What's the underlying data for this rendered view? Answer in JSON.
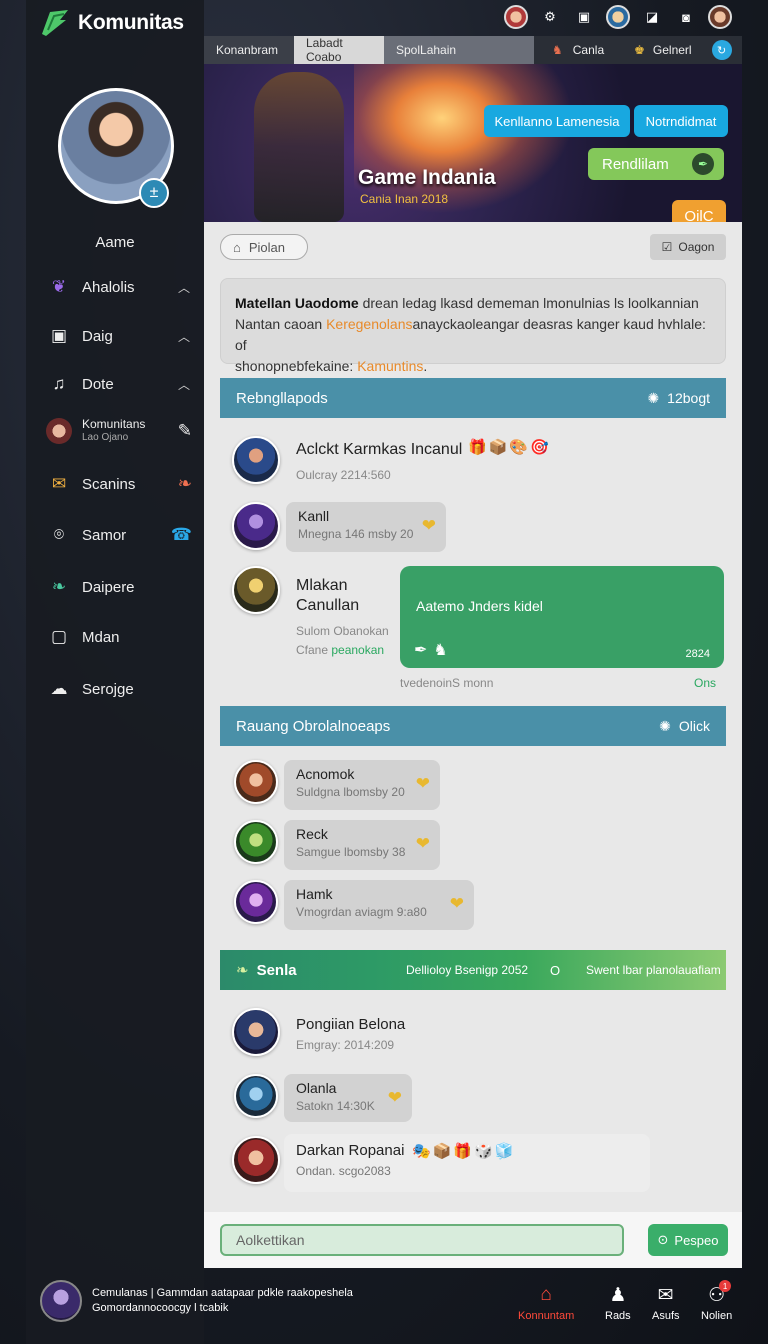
{
  "app": {
    "title": "Komunitas"
  },
  "colors": {
    "accent": "#18a8e0",
    "green": "#39a066",
    "section": "#4a90a8",
    "nav_active": "#ff4a3a"
  },
  "top_icons": [
    "avatar-icon",
    "gear-icon",
    "bookmark-icon",
    "avatar-icon",
    "chart-icon",
    "camera-icon",
    "avatar-icon"
  ],
  "sidebar": {
    "profile_name": "Aame",
    "profile_badge": "±",
    "items": [
      {
        "label": "Ahalolis",
        "icon": "feather-icon"
      },
      {
        "label": "Daig",
        "icon": "document-icon"
      },
      {
        "label": "Dote",
        "icon": "music-icon"
      },
      {
        "label": "Komunitans",
        "sub": "Lao Ojano",
        "icon": "avatar-icon"
      },
      {
        "label": "Scanins",
        "icon": "mail-icon"
      },
      {
        "label": "Samor",
        "icon": "pin-icon"
      },
      {
        "label": "Daipere",
        "icon": "leaf-icon"
      },
      {
        "label": "Mdan",
        "icon": "square-icon"
      },
      {
        "label": "Serojge",
        "icon": "cloud-icon"
      }
    ]
  },
  "tabs": [
    {
      "label": "Konanbram"
    },
    {
      "label": "Labadt Coabo"
    },
    {
      "label": "SpolLahain"
    },
    {
      "label": "Canla"
    },
    {
      "label": "Gelnerl"
    }
  ],
  "hero": {
    "title": "Game Indania",
    "subtitle": "Cania Inan 2018",
    "btn1": "Kenllanno Lamenesia",
    "btn2": "Notrndidmat",
    "btn3": "Rendlilam",
    "btn4": "OilC"
  },
  "toolbar": {
    "pill": "Piolan",
    "right_btn": "Oagon"
  },
  "info": {
    "bold": "Matellan Uaodome",
    "line1_rest": " drean ledag lkasd dememan lmonulnias ls loolkannian",
    "line2_a": "Nantan caoan ",
    "line2_orange": "Keregenolans",
    "line2_b": "anayckaoleangar deasras kanger kaud hvhlale: of",
    "line3_a": "shonopnebfekaine: ",
    "line3_orange": "Kamuntins",
    "line3_b": "."
  },
  "section1": {
    "title": "Rebngllapods",
    "right": "12bogt",
    "posts": [
      {
        "name": "Aclckt Karmkas Incanul",
        "meta": "Oulcray 2214:560"
      },
      {
        "name": "Kanll",
        "meta": "Mnegna 146 msby 20"
      },
      {
        "name": "Mlakan Canullan",
        "meta1": "Sulom Obanokan",
        "meta2a": "Cfane ",
        "meta2b": "peanokan"
      }
    ],
    "green_bubble": {
      "text": "Aatemo Jnders kidel",
      "date": "2824"
    },
    "footer_left": "tvedenoinS monn",
    "footer_right": "Ons"
  },
  "section2": {
    "title": "Rauang Obrolalnoeaps",
    "right": "Olick",
    "items": [
      {
        "name": "Acnomok",
        "meta": "Suldgna lbomsby 20"
      },
      {
        "name": "Reck",
        "meta": "Samgue lbomsby 38"
      },
      {
        "name": "Hamk",
        "meta": "Vmogrdan aviagm 9:a80"
      }
    ]
  },
  "section3": {
    "title": "Senla",
    "mid": "Dellioloy Bsenigp 2052",
    "num": "O",
    "right": "Swent lbar planolauafiam",
    "items": [
      {
        "name": "Pongiian Belona",
        "meta": "Emgray: 2014:209"
      },
      {
        "name": "Olanla",
        "meta": "Satokn 14:30K"
      },
      {
        "name": "Darkan Ropanai",
        "meta": "Ondan. scgo2083"
      }
    ]
  },
  "composer": {
    "placeholder": "Aolkettikan",
    "send": "Pespeo"
  },
  "bottom": {
    "user_line1": "Cemulanas | Gammdan aatapaar pdkle raakopeshela",
    "user_line2": "Gomordannocoocgy l tcabik",
    "nav": [
      {
        "label": "Konnuntam",
        "icon": "home-icon"
      },
      {
        "label": "Rads",
        "icon": "user-icon"
      },
      {
        "label": "Asufs",
        "icon": "mail-icon"
      },
      {
        "label": "Nolien",
        "icon": "bell-icon",
        "badge": "1"
      }
    ]
  }
}
